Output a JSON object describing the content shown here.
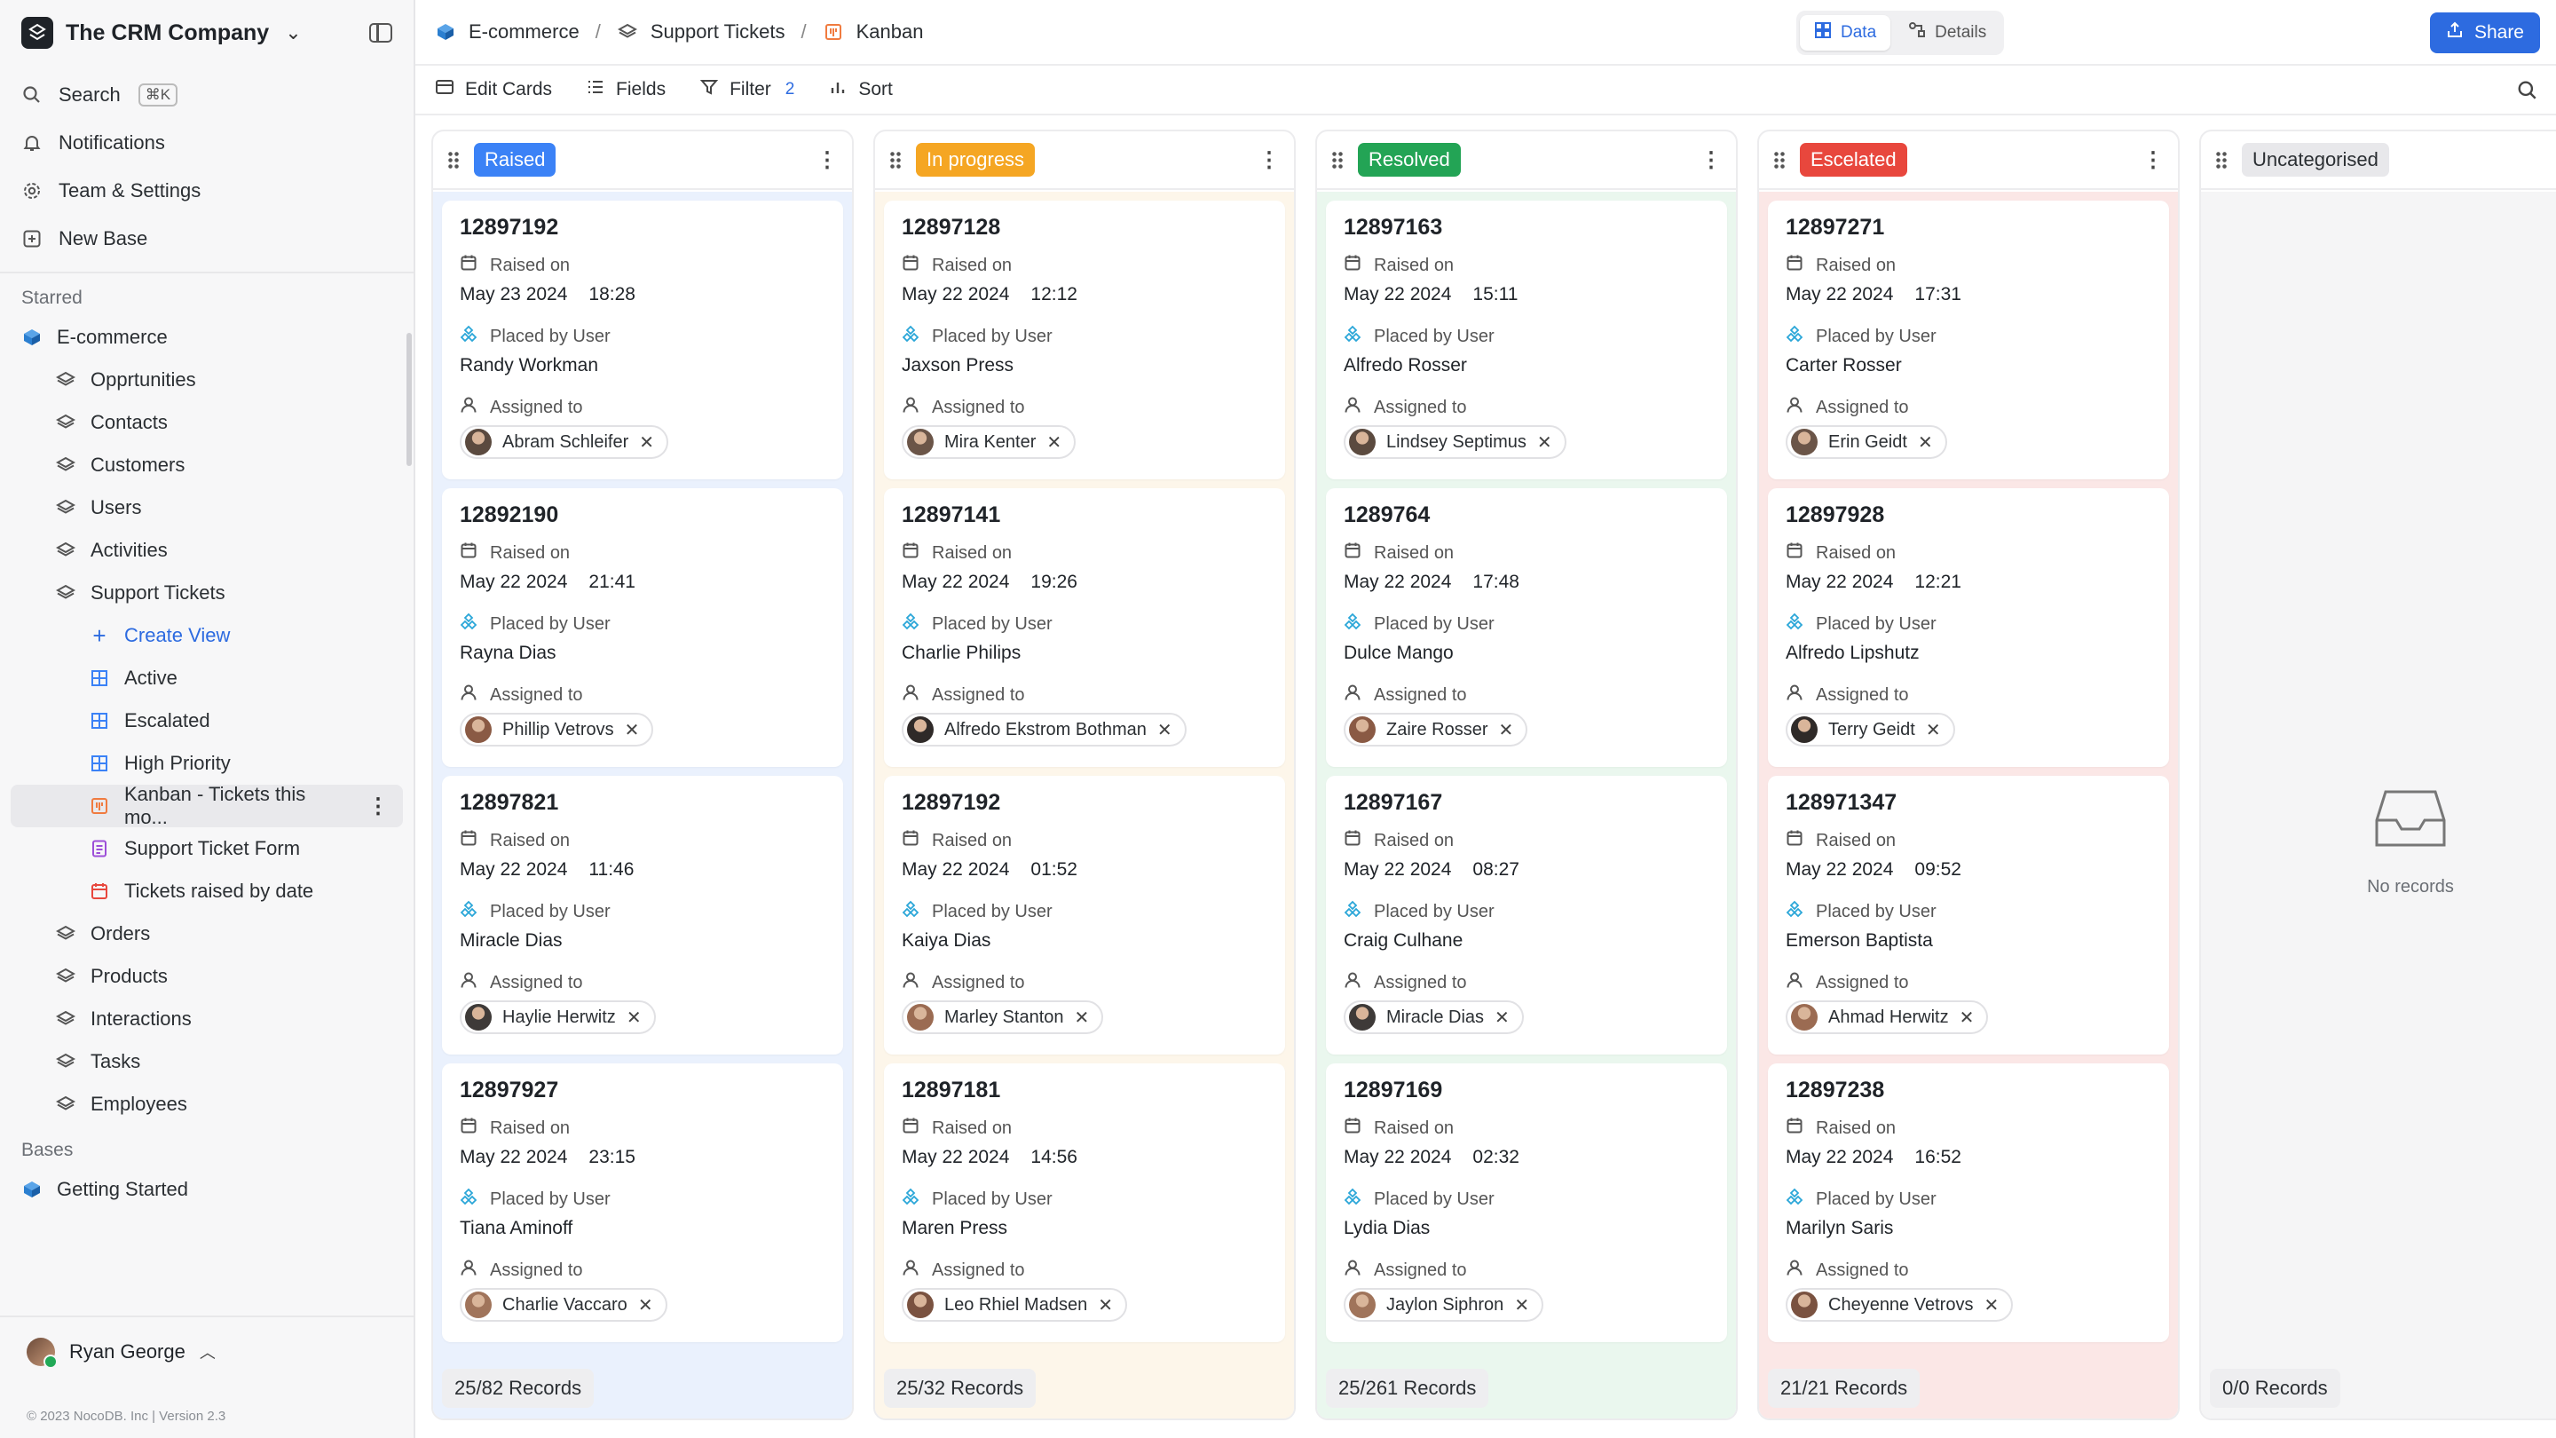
{
  "workspace": {
    "name": "The CRM Company"
  },
  "sidebar": {
    "menu": [
      {
        "label": "Search",
        "kbd": "⌘K",
        "icon": "search-icon"
      },
      {
        "label": "Notifications",
        "icon": "bell-icon"
      },
      {
        "label": "Team & Settings",
        "icon": "gear-icon"
      },
      {
        "label": "New Base",
        "icon": "plus-square-icon"
      }
    ],
    "starred_label": "Starred",
    "base": "E-commerce",
    "tables": [
      "Opprtunities",
      "Contacts",
      "Customers",
      "Users",
      "Activities",
      "Support Tickets"
    ],
    "views": {
      "create": "Create View",
      "active": "Active",
      "escalated": "Escalated",
      "high_priority": "High Priority",
      "kanban": "Kanban - Tickets this mo...",
      "form": "Support Ticket Form",
      "calendar": "Tickets raised by date"
    },
    "tables_after": [
      "Orders",
      "Products",
      "Interactions",
      "Tasks",
      "Employees"
    ],
    "bases_label": "Bases",
    "getting_started": "Getting Started",
    "user": "Ryan George",
    "footer": "© 2023 NocoDB. Inc | Version 2.3"
  },
  "breadcrumb": {
    "base": "E-commerce",
    "table": "Support Tickets",
    "view": "Kanban"
  },
  "view_toggle": {
    "data": "Data",
    "details": "Details"
  },
  "share_label": "Share",
  "toolbar": {
    "edit_cards": "Edit Cards",
    "fields": "Fields",
    "filter": "Filter",
    "filter_count": "2",
    "sort": "Sort"
  },
  "labels": {
    "raised_on": "Raised on",
    "placed_by": "Placed by User",
    "assigned_to": "Assigned to"
  },
  "columns": [
    {
      "title": "Raised",
      "color": "#3b82f6",
      "bg": "#eaf1fd",
      "footer": "25/82 Records",
      "cards": [
        {
          "id": "12897192",
          "date": "May 23 2024",
          "time": "18:28",
          "user": "Randy Workman",
          "assignee": "Abram Schleifer"
        },
        {
          "id": "12892190",
          "date": "May 22 2024",
          "time": "21:41",
          "user": "Rayna Dias",
          "assignee": "Phillip Vetrovs"
        },
        {
          "id": "12897821",
          "date": "May 22 2024",
          "time": "11:46",
          "user": "Miracle Dias",
          "assignee": "Haylie Herwitz"
        },
        {
          "id": "12897927",
          "date": "May 22 2024",
          "time": "23:15",
          "user": "Tiana Aminoff",
          "assignee": "Charlie Vaccaro"
        }
      ]
    },
    {
      "title": "In progress",
      "color": "#f5a623",
      "bg": "#fdf6ea",
      "footer": "25/32 Records",
      "cards": [
        {
          "id": "12897128",
          "date": "May 22 2024",
          "time": "12:12",
          "user": "Jaxson Press",
          "assignee": "Mira Kenter"
        },
        {
          "id": "12897141",
          "date": "May 22 2024",
          "time": "19:26",
          "user": "Charlie Philips",
          "assignee": "Alfredo Ekstrom Bothman"
        },
        {
          "id": "12897192",
          "date": "May 22 2024",
          "time": "01:52",
          "user": "Kaiya Dias",
          "assignee": "Marley Stanton"
        },
        {
          "id": "12897181",
          "date": "May 22 2024",
          "time": "14:56",
          "user": "Maren Press",
          "assignee": "Leo Rhiel Madsen"
        }
      ]
    },
    {
      "title": "Resolved",
      "color": "#23a455",
      "bg": "#eaf7ee",
      "footer": "25/261 Records",
      "cards": [
        {
          "id": "12897163",
          "date": "May 22 2024",
          "time": "15:11",
          "user": "Alfredo Rosser",
          "assignee": "Lindsey Septimus"
        },
        {
          "id": "1289764",
          "date": "May 22 2024",
          "time": "17:48",
          "user": "Dulce Mango",
          "assignee": "Zaire Rosser"
        },
        {
          "id": "12897167",
          "date": "May 22 2024",
          "time": "08:27",
          "user": "Craig Culhane",
          "assignee": "Miracle Dias"
        },
        {
          "id": "12897169",
          "date": "May 22 2024",
          "time": "02:32",
          "user": "Lydia Dias",
          "assignee": "Jaylon Siphron"
        }
      ]
    },
    {
      "title": "Escelated",
      "color": "#e8473d",
      "bg": "#fbe7e6",
      "footer": "21/21 Records",
      "cards": [
        {
          "id": "12897271",
          "date": "May 22 2024",
          "time": "17:31",
          "user": "Carter Rosser",
          "assignee": "Erin Geidt"
        },
        {
          "id": "12897928",
          "date": "May 22 2024",
          "time": "12:21",
          "user": "Alfredo Lipshutz",
          "assignee": "Terry Geidt"
        },
        {
          "id": "128971347",
          "date": "May 22 2024",
          "time": "09:52",
          "user": "Emerson Baptista",
          "assignee": "Ahmad Herwitz"
        },
        {
          "id": "12897238",
          "date": "May 22 2024",
          "time": "16:52",
          "user": "Marilyn Saris",
          "assignee": "Cheyenne Vetrovs"
        }
      ]
    },
    {
      "title": "Uncategorised",
      "color": "#e8e8eb",
      "bg": "#f5f5f6",
      "footer": "0/0 Records",
      "empty": "No records",
      "cards": []
    }
  ]
}
